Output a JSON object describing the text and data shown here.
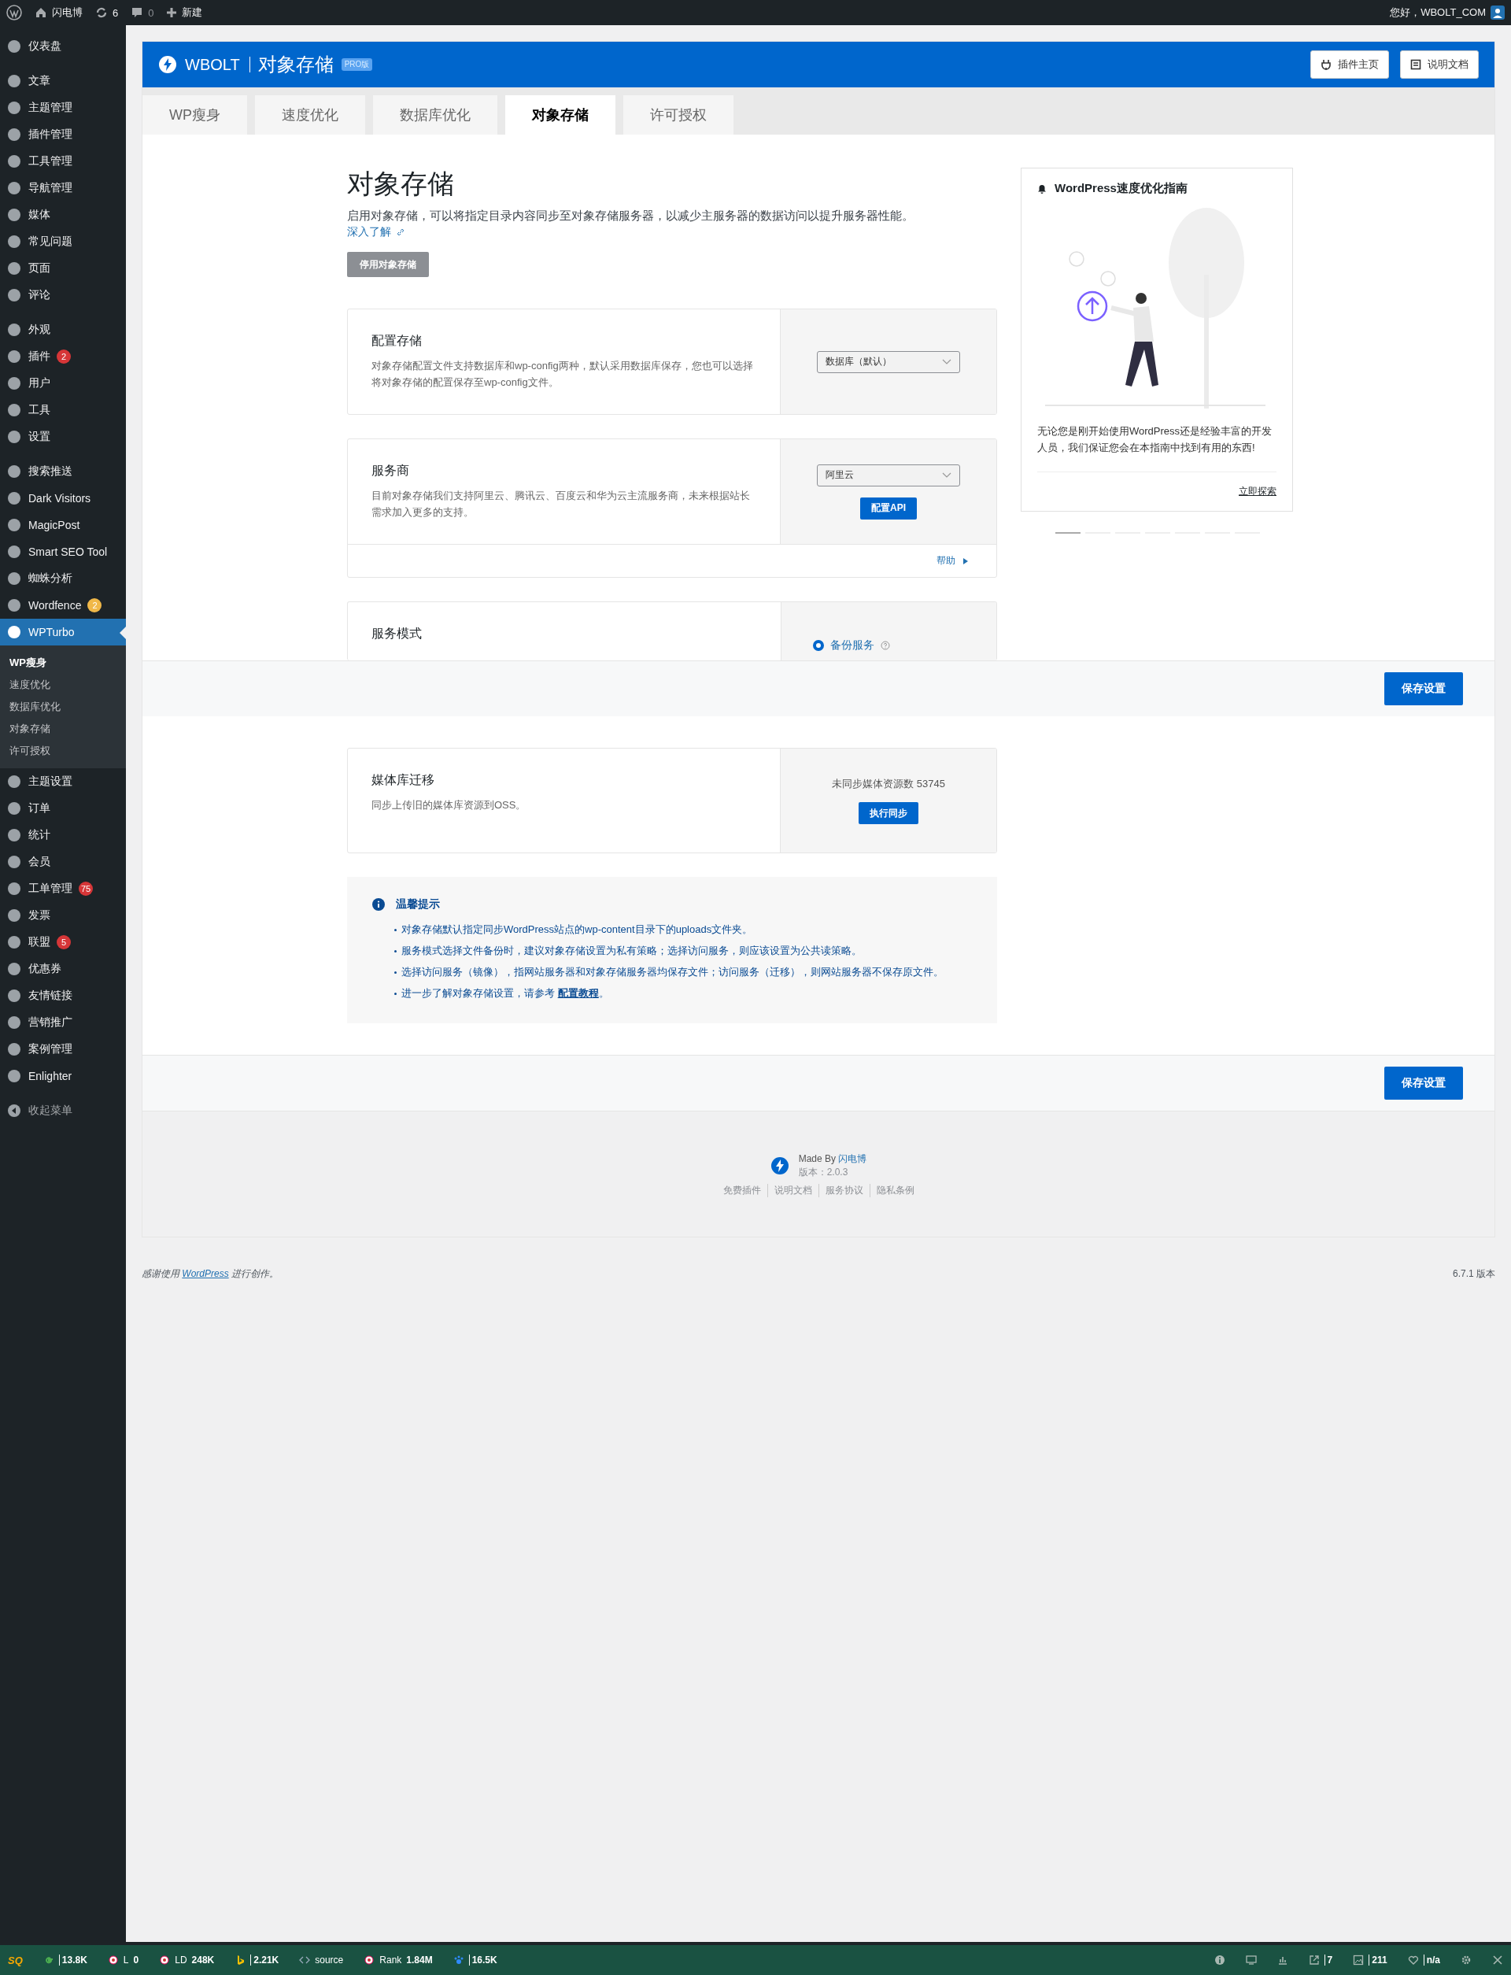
{
  "admin_bar": {
    "site": "闪电博",
    "updates": "6",
    "comments": "0",
    "new": "新建",
    "greeting": "您好，WBOLT_COM"
  },
  "sidebar": {
    "groups": [
      [
        {
          "label": "仪表盘",
          "selected": false
        }
      ],
      [
        {
          "label": "文章",
          "selected": false
        },
        {
          "label": "主题管理",
          "selected": false
        },
        {
          "label": "插件管理",
          "selected": false
        },
        {
          "label": "工具管理",
          "selected": false
        },
        {
          "label": "导航管理",
          "selected": false
        },
        {
          "label": "媒体",
          "selected": false
        },
        {
          "label": "常见问题",
          "selected": false
        },
        {
          "label": "页面",
          "selected": false
        },
        {
          "label": "评论",
          "selected": false
        }
      ],
      [
        {
          "label": "外观",
          "selected": false
        },
        {
          "label": "插件",
          "selected": false,
          "badge": {
            "text": "2",
            "color": "#d63638"
          }
        },
        {
          "label": "用户",
          "selected": false
        },
        {
          "label": "工具",
          "selected": false
        },
        {
          "label": "设置",
          "selected": false
        }
      ],
      [
        {
          "label": "搜索推送",
          "selected": false
        },
        {
          "label": "Dark Visitors",
          "selected": false
        },
        {
          "label": "MagicPost",
          "selected": false
        },
        {
          "label": "Smart SEO Tool",
          "selected": false
        },
        {
          "label": "蜘蛛分析",
          "selected": false
        },
        {
          "label": "Wordfence",
          "selected": false,
          "badge": {
            "text": "2",
            "color": "#f0b849"
          }
        },
        {
          "label": "WPTurbo",
          "selected": true,
          "children": [
            {
              "label": "WP瘦身",
              "selected": true
            },
            {
              "label": "速度优化",
              "selected": false
            },
            {
              "label": "数据库优化",
              "selected": false
            },
            {
              "label": "对象存储",
              "selected": false
            },
            {
              "label": "许可授权",
              "selected": false
            }
          ]
        },
        {
          "label": "主题设置",
          "selected": false
        },
        {
          "label": "订单",
          "selected": false
        },
        {
          "label": "统计",
          "selected": false
        },
        {
          "label": "会员",
          "selected": false
        },
        {
          "label": "工单管理",
          "selected": false,
          "badge": {
            "text": "75",
            "color": "#d63638"
          }
        },
        {
          "label": "发票",
          "selected": false
        },
        {
          "label": "联盟",
          "selected": false,
          "badge": {
            "text": "5",
            "color": "#d63638"
          }
        },
        {
          "label": "优惠券",
          "selected": false
        },
        {
          "label": "友情链接",
          "selected": false
        },
        {
          "label": "营销推广",
          "selected": false
        },
        {
          "label": "案例管理",
          "selected": false
        },
        {
          "label": "Enlighter",
          "selected": false
        }
      ]
    ],
    "collapse": "收起菜单"
  },
  "plugin_header": {
    "brand": "WBOLT",
    "title": "对象存储",
    "badge": "PRO版",
    "buttons": [
      "插件主页",
      "说明文档"
    ]
  },
  "tabs": [
    {
      "label": "WP瘦身",
      "selected": false
    },
    {
      "label": "速度优化",
      "selected": false
    },
    {
      "label": "数据库优化",
      "selected": false
    },
    {
      "label": "对象存储",
      "selected": true
    },
    {
      "label": "许可授权",
      "selected": false
    }
  ],
  "intro": {
    "title": "对象存储",
    "description": "启用对象存储，可以将指定目录内容同步至对象存储服务器，以减少主服务器的数据访问以提升服务器性能。",
    "link": "深入了解",
    "toggle_button": "停用对象存储"
  },
  "settings": [
    {
      "title": "配置存储",
      "description": "对象存储配置文件支持数据库和wp-config两种，默认采用数据库保存，您也可以选择将对象存储的配置保存至wp-config文件。",
      "select": "数据库（默认）"
    },
    {
      "title": "服务商",
      "description": "目前对象存储我们支持阿里云、腾讯云、百度云和华为云主流服务商，未来根据站长需求加入更多的支持。",
      "select": "阿里云",
      "button": "配置API",
      "help": "帮助"
    },
    {
      "title": "服务模式",
      "radio": {
        "label": "备份服务",
        "selected": true
      }
    }
  ],
  "save_buttons": [
    "保存设置",
    "保存设置"
  ],
  "migration": {
    "title": "媒体库迁移",
    "description": "同步上传旧的媒体库资源到OSS。",
    "count": "未同步媒体资源数 53745",
    "button": "执行同步"
  },
  "tips": {
    "title": "温馨提示",
    "items": [
      {
        "text": "对象存储默认指定同步WordPress站点的wp-content目录下的uploads文件夹。"
      },
      {
        "text": "服务模式选择文件备份时，建议对象存储设置为私有策略；选择访问服务，则应该设置为公共读策略。"
      },
      {
        "text": "选择访问服务（镜像），指网站服务器和对象存储服务器均保存文件；访问服务（迁移），则网站服务器不保存原文件。"
      },
      {
        "text": "进一步了解对象存储设置，请参考 ",
        "link": "配置教程",
        "after": "。"
      }
    ]
  },
  "guide": {
    "title": "WordPress速度优化指南",
    "text": "无论您是刚开始使用WordPress还是经验丰富的开发人员，我们保证您会在本指南中找到有用的东西!",
    "link": "立即探索",
    "slides": [
      {
        "selected": true
      },
      {
        "selected": false
      },
      {
        "selected": false
      },
      {
        "selected": false
      },
      {
        "selected": false
      },
      {
        "selected": false
      },
      {
        "selected": false
      }
    ]
  },
  "plugin_footer": {
    "made_by": "Made By ",
    "author": "闪电博",
    "version": "版本：2.0.3",
    "links": [
      "免费插件",
      "说明文档",
      "服务协议",
      "隐私条例"
    ]
  },
  "wp_footer": {
    "before": "感谢使用 ",
    "link": "WordPress",
    "after": " 进行创作。",
    "version": "6.7.1 版本"
  },
  "seo_bar": {
    "logo": "SQ",
    "items": [
      {
        "kind": "google",
        "value": "13.8K"
      },
      {
        "kind": "circle",
        "label": "L",
        "value": "0"
      },
      {
        "kind": "circle",
        "label": "LD",
        "value": "248K"
      },
      {
        "kind": "bing",
        "value": "2.21K"
      },
      {
        "kind": "code",
        "label": "source"
      },
      {
        "kind": "circle",
        "label": "Rank",
        "value": "1.84M"
      },
      {
        "kind": "paw",
        "value": "16.5K"
      }
    ],
    "right": [
      {
        "kind": "info"
      },
      {
        "kind": "monitor"
      },
      {
        "kind": "chart"
      },
      {
        "kind": "link",
        "value": "7"
      },
      {
        "kind": "image",
        "value": "211"
      },
      {
        "kind": "heart",
        "value": "n/a"
      },
      {
        "kind": "gear"
      },
      {
        "kind": "close"
      }
    ]
  }
}
